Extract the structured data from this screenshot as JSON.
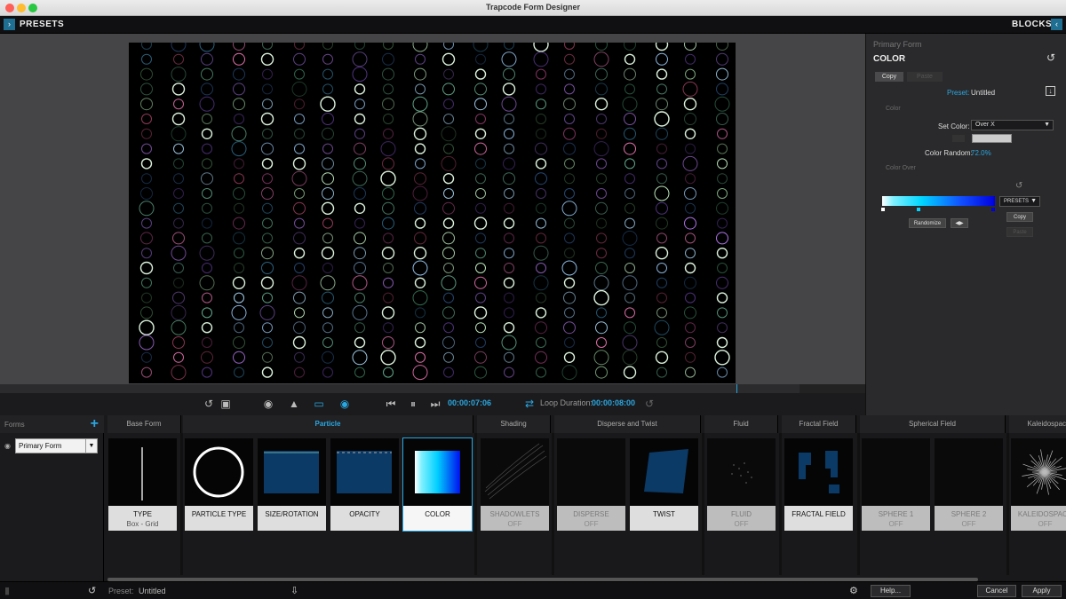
{
  "window": {
    "title": "Trapcode Form Designer"
  },
  "topbar": {
    "presets_label": "PRESETS",
    "blocks_label": "BLOCKS"
  },
  "transport": {
    "current_time": "00:00:07:06",
    "loop_label": "Loop Duration:",
    "loop_duration": "00:00:08:00"
  },
  "panel": {
    "form_name": "Primary Form",
    "section": "COLOR",
    "copy_label": "Copy",
    "paste_label": "Paste",
    "preset_label": "Preset:",
    "preset_value": "Untitled",
    "group_color": "Color",
    "set_color_label": "Set Color:",
    "set_color_value": "Over X",
    "color_random_label": "Color Random:",
    "color_random_value": "72.0%",
    "group_color_over": "Color Over",
    "presets_dropdown": "PRESETS",
    "grad_copy": "Copy",
    "grad_paste": "Paste",
    "randomize_label": "Randomize"
  },
  "forms": {
    "header": "Forms",
    "selected": "Primary Form"
  },
  "groups": [
    {
      "label": "Base Form"
    },
    {
      "label": "Particle"
    },
    {
      "label": "Shading"
    },
    {
      "label": "Disperse and Twist"
    },
    {
      "label": "Fluid"
    },
    {
      "label": "Fractal Field"
    },
    {
      "label": "Spherical Field"
    },
    {
      "label": "Kaleidospace"
    }
  ],
  "blocks": [
    {
      "label": "TYPE",
      "sub": "Box - Grid"
    },
    {
      "label": "PARTICLE TYPE",
      "sub": ""
    },
    {
      "label": "SIZE/ROTATION",
      "sub": ""
    },
    {
      "label": "OPACITY",
      "sub": ""
    },
    {
      "label": "COLOR",
      "sub": ""
    },
    {
      "label": "SHADOWLETS",
      "sub": "OFF"
    },
    {
      "label": "DISPERSE",
      "sub": "OFF"
    },
    {
      "label": "TWIST",
      "sub": ""
    },
    {
      "label": "FLUID",
      "sub": "OFF"
    },
    {
      "label": "FRACTAL FIELD",
      "sub": ""
    },
    {
      "label": "SPHERE 1",
      "sub": "OFF"
    },
    {
      "label": "SPHERE 2",
      "sub": "OFF"
    },
    {
      "label": "KALEIDOSPACE",
      "sub": "OFF"
    }
  ],
  "status": {
    "preset_label": "Preset:",
    "preset_value": "Untitled",
    "help_label": "Help...",
    "cancel_label": "Cancel",
    "apply_label": "Apply"
  },
  "colors": {
    "accent": "#29a7e1",
    "panel": "#2a2a2c",
    "viewport": "#454547"
  }
}
